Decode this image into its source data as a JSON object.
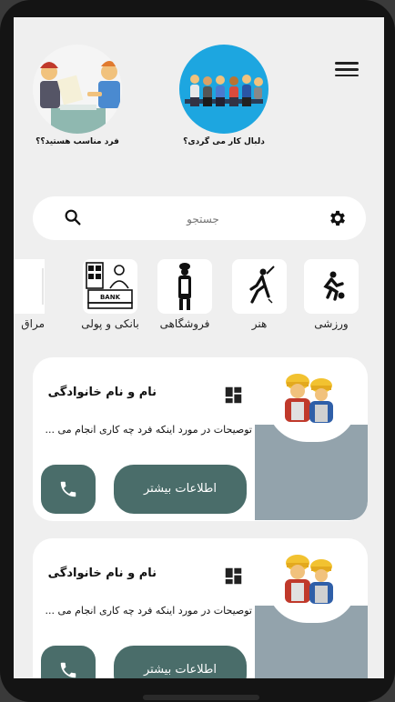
{
  "header": {
    "menu_icon": "menu-icon"
  },
  "stories": [
    {
      "caption": "دلبال کار می گردی؟",
      "icon": "job-seekers-illustration"
    },
    {
      "caption": "فرد مناسب هستید؟؟",
      "icon": "job-interview-illustration"
    }
  ],
  "search": {
    "placeholder": "جستجو",
    "settings_icon": "settings-gear-icon",
    "search_icon": "search-icon"
  },
  "categories": [
    {
      "label": "ورزشی",
      "icon": "sport-icon"
    },
    {
      "label": "هنر",
      "icon": "art-icon"
    },
    {
      "label": "فروشگاهی",
      "icon": "shop-icon"
    },
    {
      "label": "بانکی و پولی",
      "icon": "bank-icon"
    },
    {
      "label": "مراق",
      "icon": "care-icon"
    }
  ],
  "cards": [
    {
      "name": "نام و نام خانوادگی",
      "description": "توصیحات در مورد اینکه فرد چه کاری انجام می ...",
      "more_button": "اطلاعات بیشتر",
      "avatar": "workers-avatar-icon",
      "call_icon": "phone-icon",
      "grid_icon": "dashboard-icon"
    },
    {
      "name": "نام و نام خانوادگی",
      "description": "توصیحات در مورد اینکه فرد چه کاری انجام می ...",
      "more_button": "اطلاعات بیشتر",
      "avatar": "workers-avatar-icon",
      "call_icon": "phone-icon",
      "grid_icon": "dashboard-icon"
    }
  ],
  "colors": {
    "accent": "#4a6d6a",
    "card_side": "#93a3ac",
    "background": "#efefef",
    "story_blue": "#1da6e0"
  }
}
